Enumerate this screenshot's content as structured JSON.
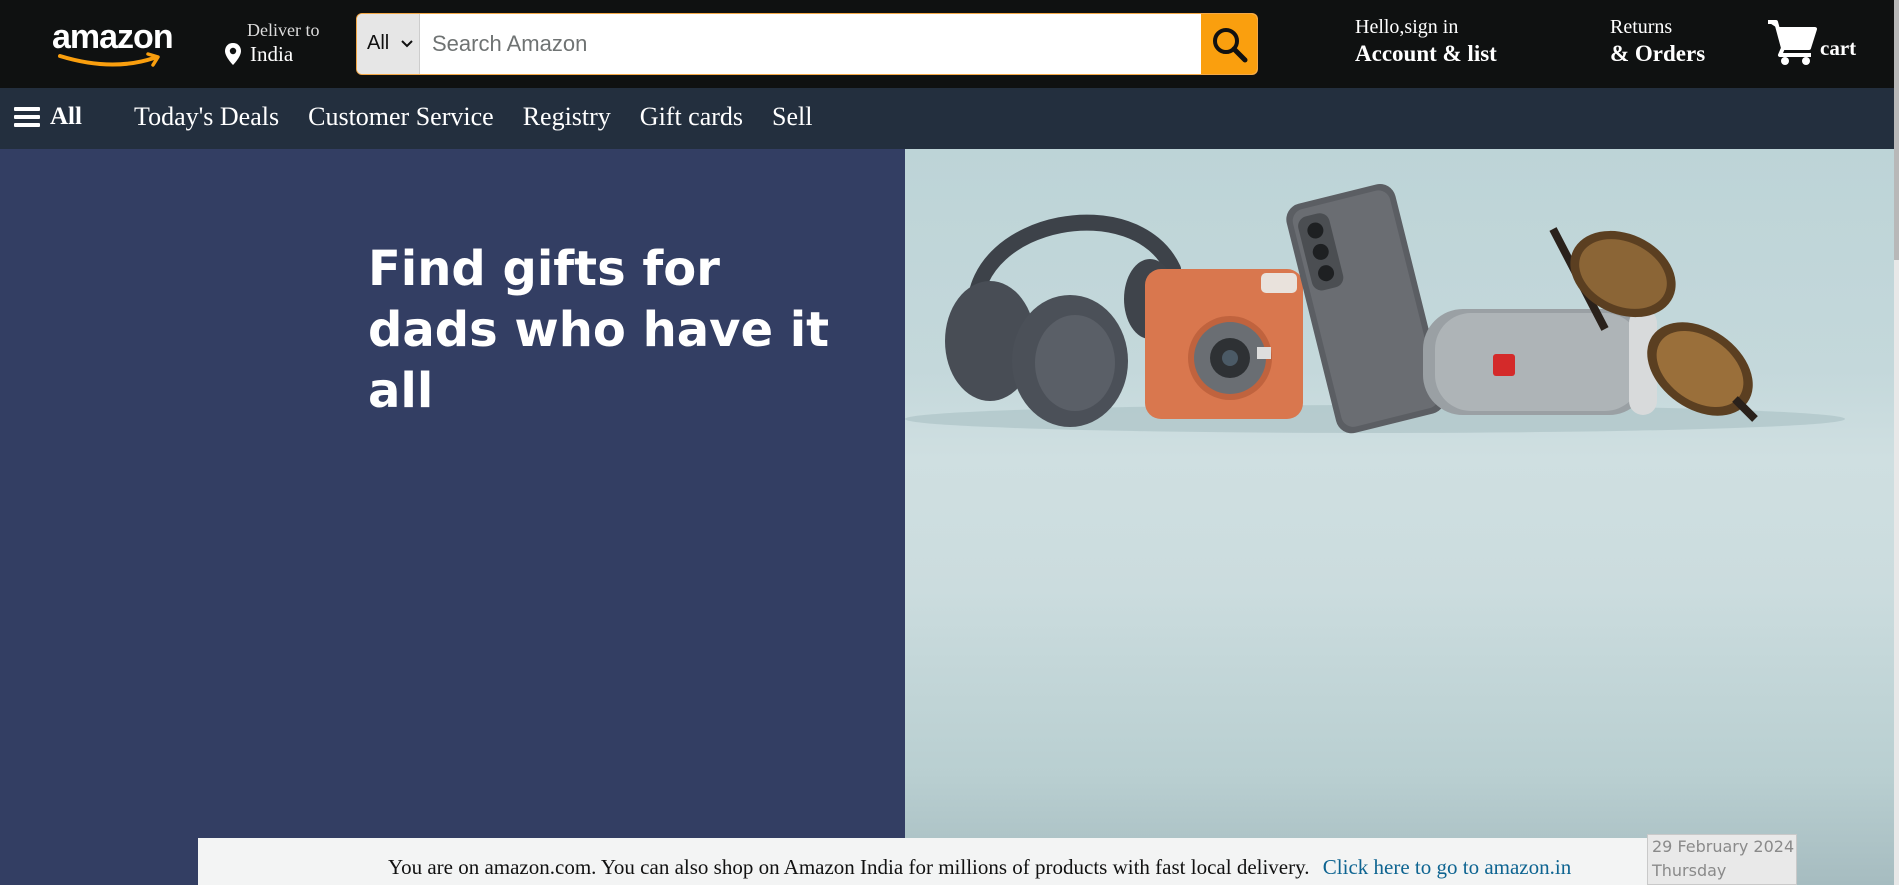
{
  "header": {
    "logo_text": "amazon",
    "deliver_label": "Deliver to",
    "deliver_location": "India",
    "search": {
      "category": "All",
      "placeholder": "Search Amazon"
    },
    "account_greeting": "Hello,sign in",
    "account_label": "Account & list",
    "returns_label": "Returns",
    "orders_label": "& Orders",
    "cart_label": "cart"
  },
  "nav": {
    "all_label": "All",
    "links": [
      "Today's Deals",
      "Customer Service",
      "Registry",
      "Gift cards",
      "Sell"
    ]
  },
  "hero": {
    "title_line1": "Find gifts for",
    "title_line2": "dads who have it all",
    "colors": {
      "left_panel": "#333e63",
      "right_panel": "#c4d8db"
    },
    "products": [
      "headphones",
      "instant camera",
      "smartphone",
      "speaker",
      "sunglasses"
    ]
  },
  "notice": {
    "message": "You are on amazon.com. You can also shop on Amazon India for millions of products with fast local delivery.",
    "link_text": "Click here to go to amazon.in"
  },
  "datebox": {
    "date": "29 February 2024",
    "day": "Thursday"
  },
  "colors": {
    "header_bg": "#0f1111",
    "nav_bg": "#232f3e",
    "accent": "#fa9f0e"
  }
}
